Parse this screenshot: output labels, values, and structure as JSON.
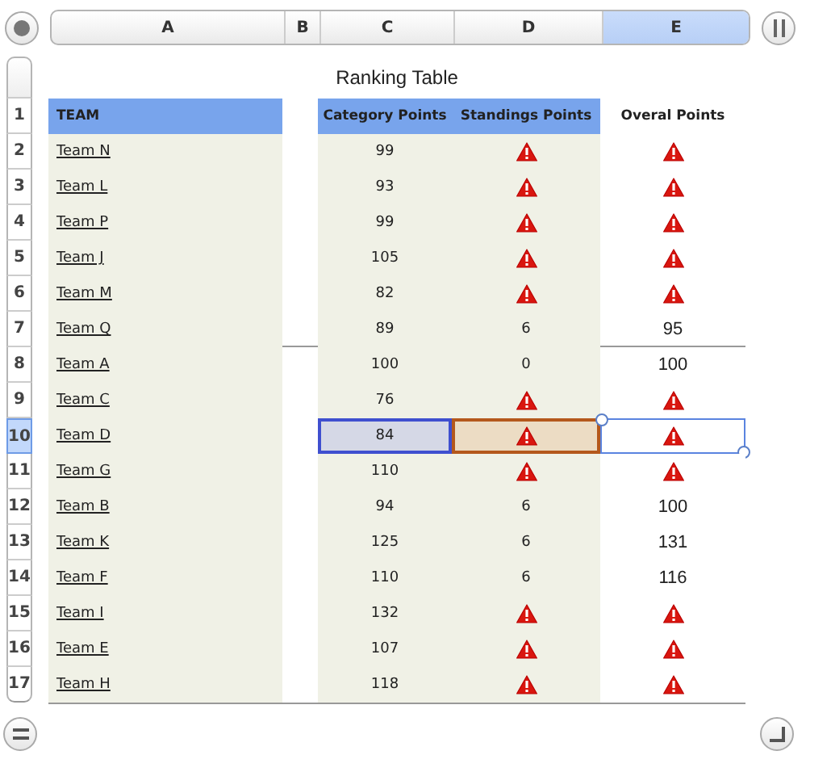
{
  "columns": [
    {
      "label": "A",
      "selected": false
    },
    {
      "label": "B",
      "selected": false
    },
    {
      "label": "C",
      "selected": false
    },
    {
      "label": "D",
      "selected": false
    },
    {
      "label": "E",
      "selected": true
    }
  ],
  "title": "Ranking Table",
  "header": {
    "number": "1",
    "team": "TEAM",
    "category": "Category Points",
    "standings": "Standings Points",
    "overall": "Overal Points"
  },
  "rows": [
    {
      "number": "2",
      "team": "Team N",
      "category": "99",
      "standings": {
        "kind": "warning"
      },
      "overall": {
        "kind": "warning"
      },
      "selected": false,
      "rule_below": false
    },
    {
      "number": "3",
      "team": "Team L",
      "category": "93",
      "standings": {
        "kind": "warning"
      },
      "overall": {
        "kind": "warning"
      },
      "selected": false,
      "rule_below": false
    },
    {
      "number": "4",
      "team": "Team P",
      "category": "99",
      "standings": {
        "kind": "warning"
      },
      "overall": {
        "kind": "warning"
      },
      "selected": false,
      "rule_below": false
    },
    {
      "number": "5",
      "team": "Team J",
      "category": "105",
      "standings": {
        "kind": "warning"
      },
      "overall": {
        "kind": "warning"
      },
      "selected": false,
      "rule_below": false
    },
    {
      "number": "6",
      "team": "Team M",
      "category": "82",
      "standings": {
        "kind": "warning"
      },
      "overall": {
        "kind": "warning"
      },
      "selected": false,
      "rule_below": false
    },
    {
      "number": "7",
      "team": "Team Q",
      "category": "89",
      "standings": {
        "kind": "text",
        "text": "6"
      },
      "overall": {
        "kind": "text",
        "text": "95"
      },
      "selected": false,
      "rule_below": true
    },
    {
      "number": "8",
      "team": "Team A",
      "category": "100",
      "standings": {
        "kind": "text",
        "text": "0"
      },
      "overall": {
        "kind": "text",
        "text": "100"
      },
      "selected": false,
      "rule_below": false
    },
    {
      "number": "9",
      "team": "Team C",
      "category": "76",
      "standings": {
        "kind": "warning"
      },
      "overall": {
        "kind": "warning"
      },
      "selected": false,
      "rule_below": false
    },
    {
      "number": "10",
      "team": "Team D",
      "category": "84",
      "standings": {
        "kind": "warning"
      },
      "overall": {
        "kind": "warning"
      },
      "selected": true,
      "rule_below": false
    },
    {
      "number": "11",
      "team": "Team G",
      "category": "110",
      "standings": {
        "kind": "warning"
      },
      "overall": {
        "kind": "warning"
      },
      "selected": false,
      "rule_below": false
    },
    {
      "number": "12",
      "team": "Team B",
      "category": "94",
      "standings": {
        "kind": "text",
        "text": "6"
      },
      "overall": {
        "kind": "text",
        "text": "100"
      },
      "selected": false,
      "rule_below": false
    },
    {
      "number": "13",
      "team": "Team K",
      "category": "125",
      "standings": {
        "kind": "text",
        "text": "6"
      },
      "overall": {
        "kind": "text",
        "text": "131"
      },
      "selected": false,
      "rule_below": false
    },
    {
      "number": "14",
      "team": "Team F",
      "category": "110",
      "standings": {
        "kind": "text",
        "text": "6"
      },
      "overall": {
        "kind": "text",
        "text": "116"
      },
      "selected": false,
      "rule_below": false
    },
    {
      "number": "15",
      "team": "Team I",
      "category": "132",
      "standings": {
        "kind": "warning"
      },
      "overall": {
        "kind": "warning"
      },
      "selected": false,
      "rule_below": false
    },
    {
      "number": "16",
      "team": "Team E",
      "category": "107",
      "standings": {
        "kind": "warning"
      },
      "overall": {
        "kind": "warning"
      },
      "selected": false,
      "rule_below": false
    },
    {
      "number": "17",
      "team": "Team H",
      "category": "118",
      "standings": {
        "kind": "warning"
      },
      "overall": {
        "kind": "warning"
      },
      "selected": false,
      "rule_below": false
    }
  ]
}
